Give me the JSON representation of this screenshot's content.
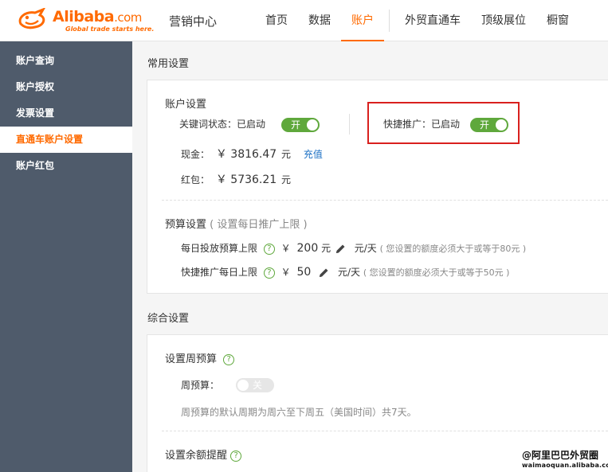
{
  "brand": {
    "logo_name": "Alibaba",
    "logo_suffix": ".com",
    "logo_slogan": "Global trade starts here.",
    "accent_color": "#ff6a00"
  },
  "header": {
    "site_title": "营销中心",
    "nav": [
      "首页",
      "数据",
      "账户",
      "外贸直通车",
      "顶级展位",
      "橱窗"
    ],
    "active_nav": "账户"
  },
  "sidebar": {
    "items": [
      {
        "label": "账户查询"
      },
      {
        "label": "账户授权"
      },
      {
        "label": "发票设置"
      },
      {
        "label": "直通车账户设置"
      },
      {
        "label": "账户红包"
      }
    ],
    "active_item": "直通车账户设置",
    "background_color": "#4f5b6b"
  },
  "common_settings": {
    "title": "常用设置",
    "account": {
      "title": "账户设置",
      "keyword_status_label": "关键词状态：已启动",
      "keyword_toggle": "开",
      "quick_promo_label": "快捷推广：已启动",
      "quick_promo_toggle": "开",
      "cash_label": "现金：",
      "cash_value": "￥ 3816.47",
      "cash_unit": "元",
      "recharge_link": "充值",
      "redpacket_label": "红包：",
      "redpacket_value": "￥ 5736.21",
      "redpacket_unit": "元"
    },
    "budget": {
      "title": "预算设置",
      "subtitle": "( 设置每日推广上限 )",
      "daily_label": "每日投放预算上限",
      "daily_currency": "￥",
      "daily_value": "200",
      "daily_unit": "元",
      "daily_per": "元/天",
      "daily_hint": "( 您设置的额度必须大于或等于80元 )",
      "quick_label": "快捷推广每日上限",
      "quick_currency": "￥",
      "quick_value": "50",
      "quick_per": "元/天",
      "quick_hint": "( 您设置的额度必须大于或等于50元 )"
    }
  },
  "general_settings": {
    "title": "综合设置",
    "weekly_title": "设置周预算",
    "weekly_label": "周预算：",
    "weekly_toggle": "关",
    "weekly_note": "周预算的默认周期为周六至下周五（美国时间）共7天。",
    "balance_title": "设置余额提醒"
  },
  "icons": {
    "help": "?",
    "edit": "pencil-icon"
  },
  "watermark": {
    "line1": "@阿里巴巴外贸圈",
    "line2": "waimaoquan.alibaba.com"
  },
  "colors": {
    "toggle_on": "#5fa83c",
    "toggle_off": "#e6e6e6",
    "highlight": "#d9201e",
    "link": "#1a6fc4"
  }
}
